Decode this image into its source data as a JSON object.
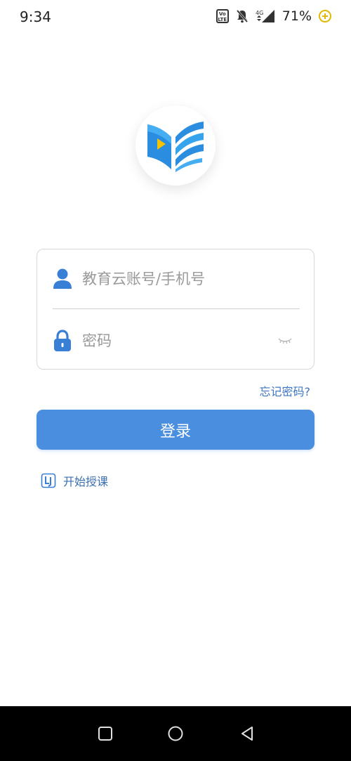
{
  "status_bar": {
    "time": "9:34",
    "network": "4G",
    "battery": "71%",
    "icons": [
      "volte-icon",
      "notifications-off-icon",
      "signal-icon",
      "battery-saver-icon"
    ]
  },
  "logo": {
    "icon": "open-book-play-logo",
    "colors": {
      "primary": "#2a8de0",
      "secondary": "#35b3f0",
      "play": "#f5c400"
    }
  },
  "form": {
    "account": {
      "value": "",
      "placeholder": "教育云账号/手机号",
      "icon": "user-icon"
    },
    "password": {
      "value": "",
      "placeholder": "密码",
      "icon": "lock-icon",
      "toggle_icon": "eye-closed-icon"
    }
  },
  "forgot_password": "忘记密码?",
  "login_button": "登录",
  "start_teaching": {
    "label": "开始授课",
    "icon": "teaching-app-icon"
  },
  "nav_bar": {
    "buttons": [
      "recent-apps-icon",
      "home-icon",
      "back-icon"
    ]
  },
  "theme": {
    "accent": "#4a8ee0",
    "link": "#3d76c2",
    "icon_blue": "#3a7fd6"
  }
}
